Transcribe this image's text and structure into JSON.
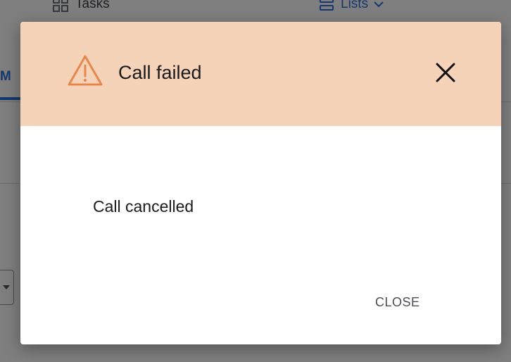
{
  "nav": {
    "tasks_label": "Tasks",
    "lists_label": "Lists"
  },
  "tab": {
    "active_label": "M"
  },
  "dialog": {
    "title": "Call failed",
    "message": "Call cancelled",
    "close_button_label": "CLOSE",
    "header_color": "#f5d3b9",
    "warning_color": "#e8874a"
  },
  "icons": {
    "warning": "warning-triangle-icon",
    "close": "close-icon",
    "tasks": "grid-icon",
    "lists": "list-icon",
    "lists_dropdown": "chevron-down-icon"
  }
}
